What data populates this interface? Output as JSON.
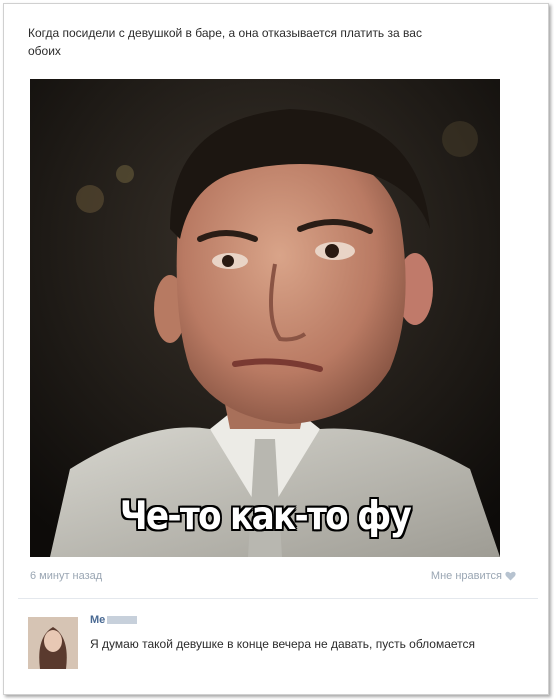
{
  "post": {
    "text": "Когда посидели с девушкой в баре, а она отказывается платить за вас обоих",
    "image_caption": "Че-то как-то фу",
    "timestamp": "6 минут назад",
    "like_label": "Мне нравится",
    "like_icon": "heart-icon"
  },
  "comment": {
    "author": "Ме",
    "text": "Я думаю такой девушке в конце вечера не давать, пусть обломается"
  },
  "colors": {
    "meta_text": "#9aa6b3",
    "author_link": "#4a6a93",
    "body_text": "#2b2b2b"
  }
}
